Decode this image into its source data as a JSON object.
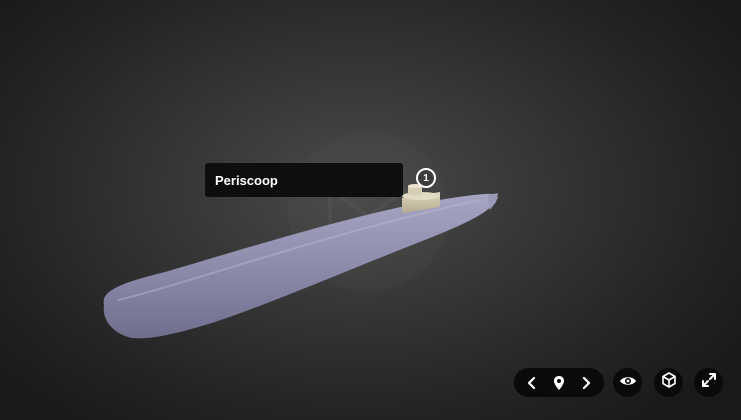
{
  "annotation": {
    "number": "1",
    "title": "Periscoop"
  },
  "controls": {
    "previous_icon": "chevron-left-icon",
    "annotations_icon": "map-pin-icon",
    "next_icon": "chevron-right-icon",
    "visibility_icon": "eye-icon",
    "view_3d_icon": "cube-icon",
    "fullscreen_icon": "expand-icon"
  },
  "colors": {
    "background": "#2a2a2a",
    "hull": "#8a89a8",
    "tower": "#c8bfa6",
    "control_bg": "#0a0a0a",
    "tooltip_bg": "#0e0e0e"
  }
}
